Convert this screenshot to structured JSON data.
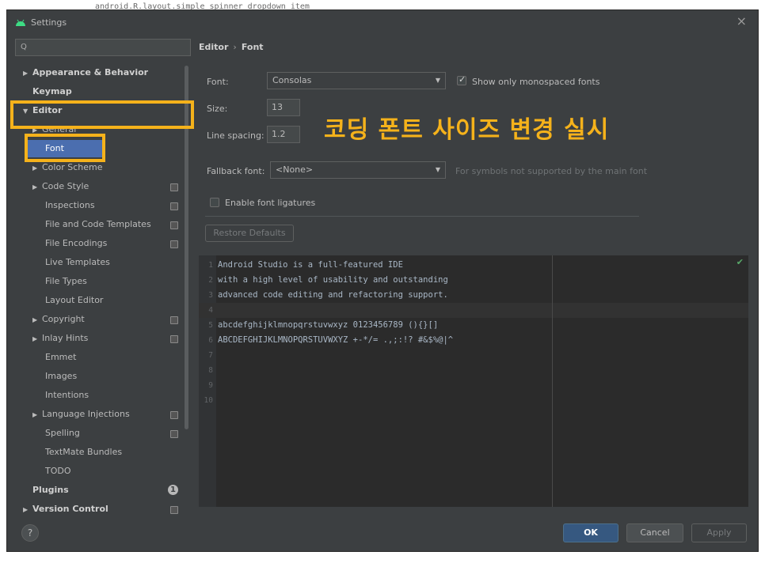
{
  "background_editor": {
    "text": "android.R.layout.simple_spinner_dropdown_item"
  },
  "window": {
    "title": "Settings",
    "close_glyph": "×"
  },
  "search": {
    "placeholder": "Q"
  },
  "tree": {
    "items": [
      {
        "label": "Appearance & Behavior",
        "bold": true,
        "arrow": "▶"
      },
      {
        "label": "Keymap",
        "bold": true
      },
      {
        "label": "Editor",
        "bold": true,
        "arrow": "▼"
      },
      {
        "label": "General",
        "arrow": "▶"
      },
      {
        "label": "Font",
        "selected": true
      },
      {
        "label": "Color Scheme",
        "arrow": "▶"
      },
      {
        "label": "Code Style",
        "arrow": "▶",
        "copy": true
      },
      {
        "label": "Inspections",
        "copy": true
      },
      {
        "label": "File and Code Templates",
        "copy": true
      },
      {
        "label": "File Encodings",
        "copy": true
      },
      {
        "label": "Live Templates"
      },
      {
        "label": "File Types"
      },
      {
        "label": "Layout Editor"
      },
      {
        "label": "Copyright",
        "arrow": "▶",
        "copy": true
      },
      {
        "label": "Inlay Hints",
        "arrow": "▶",
        "copy": true
      },
      {
        "label": "Emmet"
      },
      {
        "label": "Images"
      },
      {
        "label": "Intentions"
      },
      {
        "label": "Language Injections",
        "arrow": "▶",
        "copy": true
      },
      {
        "label": "Spelling",
        "copy": true
      },
      {
        "label": "TextMate Bundles"
      },
      {
        "label": "TODO"
      },
      {
        "label": "Plugins",
        "bold": true,
        "badge": "1"
      },
      {
        "label": "Version Control",
        "bold": true,
        "arrow": "▶",
        "copy": true
      }
    ]
  },
  "breadcrumb": {
    "parent": "Editor",
    "separator": "›",
    "current": "Font"
  },
  "font_settings": {
    "font_label": "Font:",
    "font_value": "Consolas",
    "monospaced_label": "Show only monospaced fonts",
    "monospaced_checked": true,
    "size_label": "Size:",
    "size_value": "13",
    "line_spacing_label": "Line spacing:",
    "line_spacing_value": "1.2",
    "fallback_label": "Fallback font:",
    "fallback_value": "<None>",
    "fallback_hint": "For symbols not supported by the main font",
    "ligatures_label": "Enable font ligatures",
    "ligatures_checked": false,
    "restore_label": "Restore Defaults"
  },
  "annotation": {
    "text": "코딩 폰트 사이즈 변경 실시",
    "color": "#f5b21b"
  },
  "preview": {
    "lines": [
      {
        "n": "1",
        "text": "Android Studio is a full-featured IDE"
      },
      {
        "n": "2",
        "text": "with a high level of usability and outstanding"
      },
      {
        "n": "3",
        "text": "advanced code editing and refactoring support."
      },
      {
        "n": "4",
        "text": ""
      },
      {
        "n": "5",
        "text": "abcdefghijklmnopqrstuvwxyz 0123456789 (){}[]"
      },
      {
        "n": "6",
        "text": "ABCDEFGHIJKLMNOPQRSTUVWXYZ +-*/= .,;:!? #&$%@|^"
      },
      {
        "n": "7",
        "text": ""
      },
      {
        "n": "8",
        "text": ""
      },
      {
        "n": "9",
        "text": ""
      },
      {
        "n": "10",
        "text": ""
      }
    ]
  },
  "footer": {
    "help": "?",
    "ok": "OK",
    "cancel": "Cancel",
    "apply": "Apply"
  },
  "colors": {
    "accent_selection": "#4b6eaf",
    "highlight": "#f5b21b",
    "ok_button": "#365880"
  }
}
